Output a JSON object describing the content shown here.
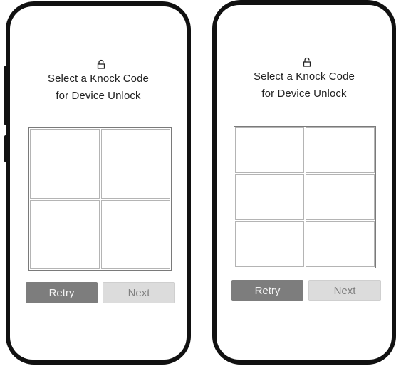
{
  "screens": [
    {
      "lock_icon": "unlocked-padlock-icon",
      "title_line1": "Select a Knock Code",
      "title_prefix": "for ",
      "title_link": "Device Unlock",
      "grid_cells": 4,
      "retry_label": "Retry",
      "next_label": "Next"
    },
    {
      "lock_icon": "unlocked-padlock-icon",
      "title_line1": "Select a Knock Code",
      "title_prefix": "for ",
      "title_link": "Device Unlock",
      "grid_cells": 6,
      "retry_label": "Retry",
      "next_label": "Next"
    }
  ],
  "colors": {
    "phone_frame": "#111111",
    "retry_bg": "#7d7d7d",
    "next_bg": "#dcdcdc"
  }
}
